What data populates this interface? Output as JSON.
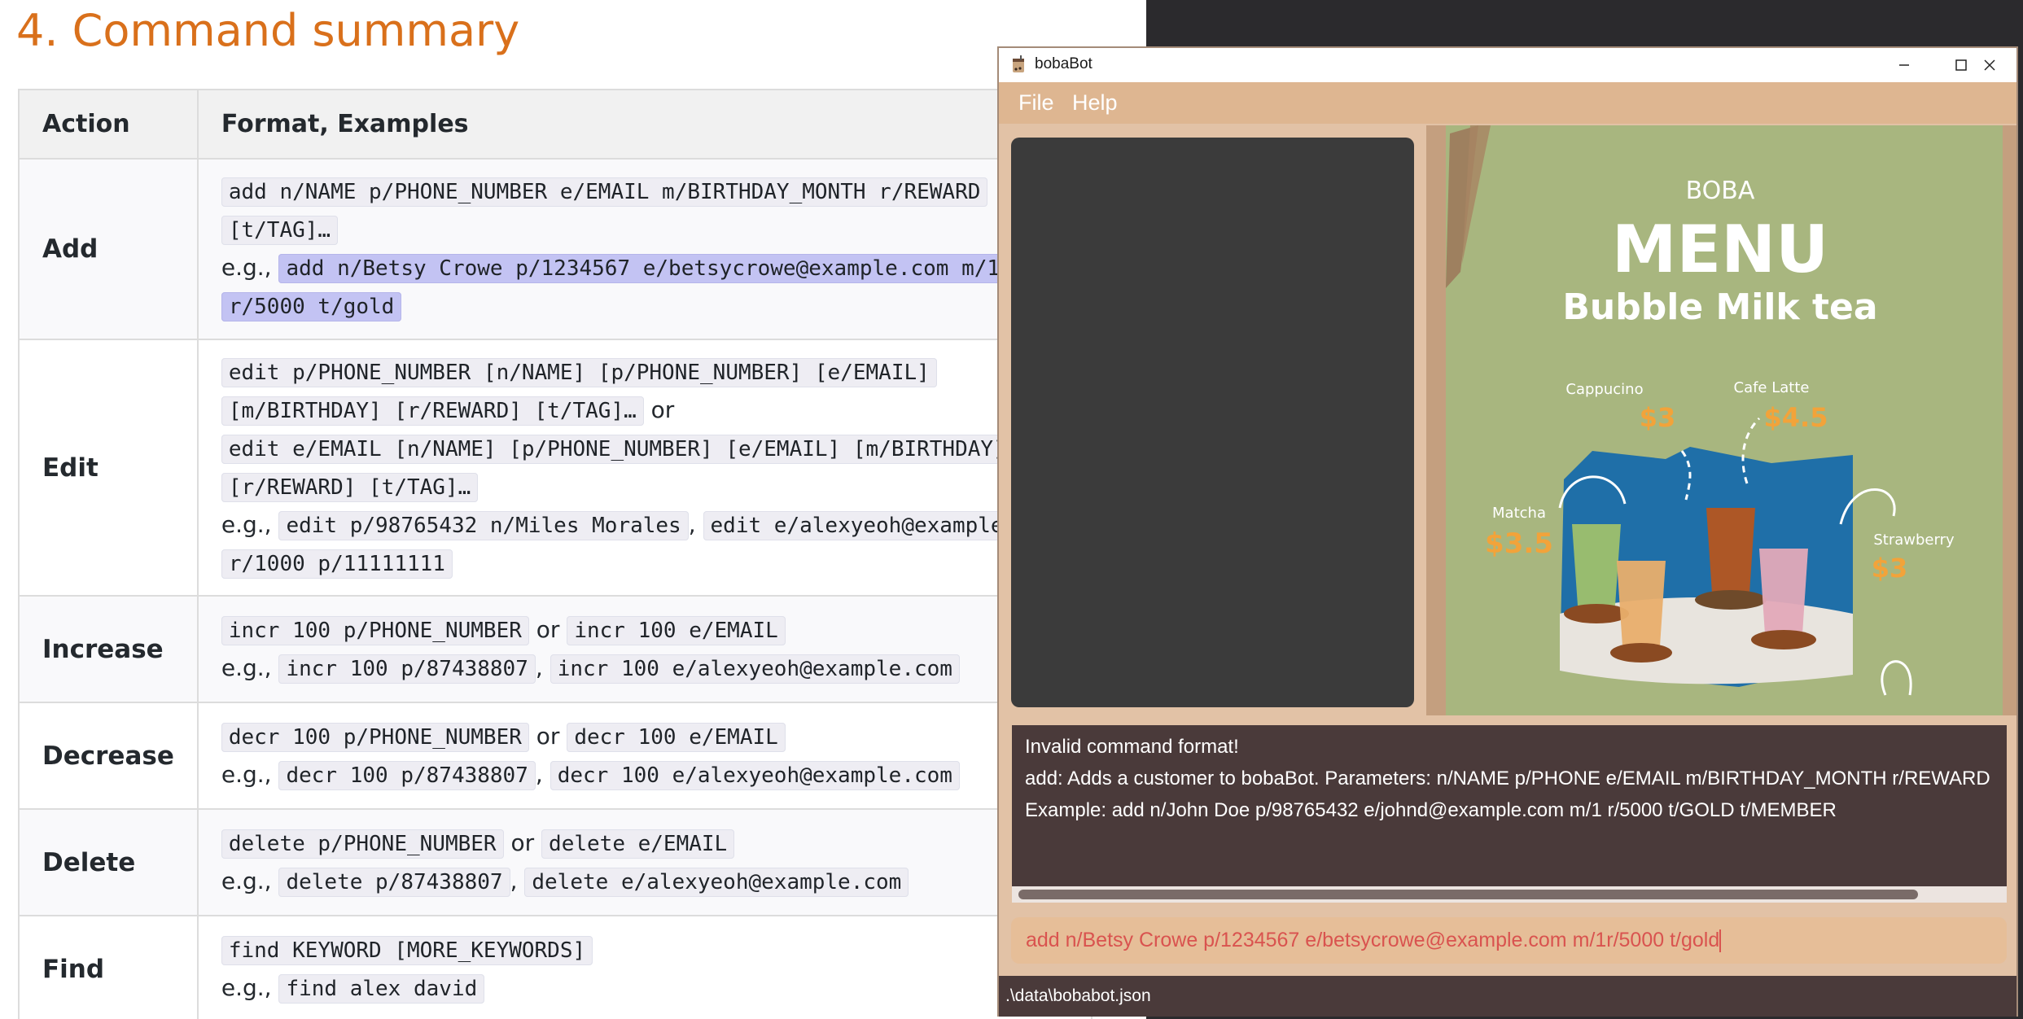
{
  "doc": {
    "heading": "4. Command summary",
    "table": {
      "headers": [
        "Action",
        "Format, Examples"
      ],
      "rows": [
        {
          "action": "Add",
          "format": [
            "add n/NAME p/PHONE_NUMBER e/EMAIL m/BIRTHDAY_MONTH r/REWARD",
            "[t/TAG]…"
          ],
          "eg": "e.g.,",
          "example": [
            "add n/Betsy Crowe p/1234567 e/betsycrowe@example.com m/1",
            "r/5000 t/gold"
          ]
        },
        {
          "action": "Edit",
          "format": [
            "edit p/PHONE_NUMBER [n/NAME] [p/PHONE_NUMBER] [e/EMAIL]",
            "[m/BIRTHDAY] [r/REWARD] [t/TAG]…",
            "edit e/EMAIL [n/NAME] [p/PHONE_NUMBER] [e/EMAIL] [m/BIRTHDAY]",
            "[r/REWARD] [t/TAG]…"
          ],
          "or": "or",
          "eg": "e.g.,",
          "examples": [
            "edit p/98765432 n/Miles Morales",
            "edit e/alexyeoh@example.c",
            "r/1000 p/11111111"
          ]
        },
        {
          "action": "Increase",
          "format": [
            "incr 100 p/PHONE_NUMBER",
            "incr 100 e/EMAIL"
          ],
          "or": "or",
          "eg": "e.g.,",
          "examples": [
            "incr 100 p/87438807",
            "incr 100 e/alexyeoh@example.com"
          ]
        },
        {
          "action": "Decrease",
          "format": [
            "decr 100 p/PHONE_NUMBER",
            "decr 100 e/EMAIL"
          ],
          "or": "or",
          "eg": "e.g.,",
          "examples": [
            "decr 100 p/87438807",
            "decr 100 e/alexyeoh@example.com"
          ]
        },
        {
          "action": "Delete",
          "format": [
            "delete p/PHONE_NUMBER",
            "delete e/EMAIL"
          ],
          "or": "or",
          "eg": "e.g.,",
          "examples": [
            "delete p/87438807",
            "delete e/alexyeoh@example.com"
          ]
        },
        {
          "action": "Find",
          "format": [
            "find KEYWORD [MORE_KEYWORDS]"
          ],
          "eg": "e.g.,",
          "examples": [
            "find alex david"
          ]
        }
      ]
    }
  },
  "app": {
    "title": "bobaBot",
    "menu": [
      "File",
      "Help"
    ],
    "poster": {
      "subtitle": "BOBA",
      "title": "MENU",
      "tagline": "Bubble Milk tea",
      "items": [
        {
          "name": "Cappucino",
          "price": "$3"
        },
        {
          "name": "Cafe Latte",
          "price": "$4.5"
        },
        {
          "name": "Matcha",
          "price": "$3.5"
        },
        {
          "name": "Strawberry",
          "price": "$3"
        }
      ]
    },
    "result": [
      "Invalid command format!",
      "add: Adds a customer to bobaBot. Parameters: n/NAME p/PHONE e/EMAIL m/BIRTHDAY_MONTH r/REWARD",
      "Example: add n/John Doe p/98765432 e/johnd@example.com m/1 r/5000 t/GOLD t/MEMBER"
    ],
    "command_input": "add n/Betsy Crowe p/1234567 e/betsycrowe@example.com m/1r/5000 t/gold",
    "status": ".\\data\\bobabot.json",
    "colors": {
      "menubar": "#deb691",
      "result_bg": "#4a3a3a",
      "command_text": "#d9534f",
      "poster_bg": "#a8b67f"
    }
  }
}
